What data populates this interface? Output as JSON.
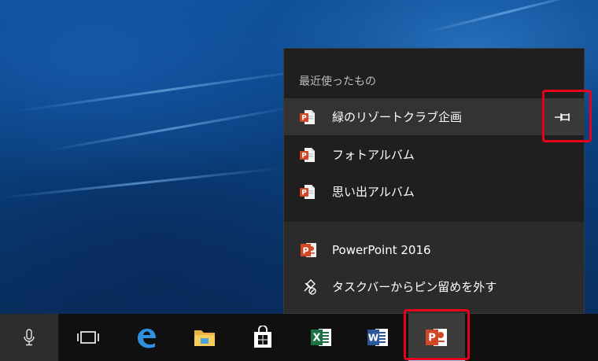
{
  "jump_list": {
    "section_title": "最近使ったもの",
    "recent": [
      {
        "label": "緑のリゾートクラブ企画",
        "icon": "powerpoint-doc-icon",
        "hovered": true
      },
      {
        "label": "フォトアルバム",
        "icon": "powerpoint-doc-icon"
      },
      {
        "label": "思い出アルバム",
        "icon": "powerpoint-doc-icon"
      }
    ],
    "tasks": [
      {
        "label": "PowerPoint 2016",
        "icon": "powerpoint-app-icon"
      },
      {
        "label": "タスクバーからピン留めを外す",
        "icon": "unpin-icon"
      }
    ],
    "pin_icon": "pin-icon"
  },
  "taskbar": {
    "items": [
      {
        "name": "cortana-mic",
        "icon": "microphone-icon"
      },
      {
        "name": "task-view",
        "icon": "task-view-icon"
      },
      {
        "name": "edge",
        "icon": "edge-icon"
      },
      {
        "name": "file-explorer",
        "icon": "folder-icon"
      },
      {
        "name": "store",
        "icon": "store-icon"
      },
      {
        "name": "excel",
        "icon": "excel-icon",
        "letter": "X"
      },
      {
        "name": "word",
        "icon": "word-icon",
        "letter": "W"
      },
      {
        "name": "powerpoint",
        "icon": "powerpoint-icon",
        "letter": "P",
        "active": true
      }
    ]
  },
  "colors": {
    "highlight": "#e8001c",
    "powerpoint": "#d24726",
    "excel": "#1e7145",
    "word": "#2b579a",
    "edge": "#0078d7",
    "taskbar": "#101010",
    "jump_list_bg": "#2b2b2b"
  }
}
